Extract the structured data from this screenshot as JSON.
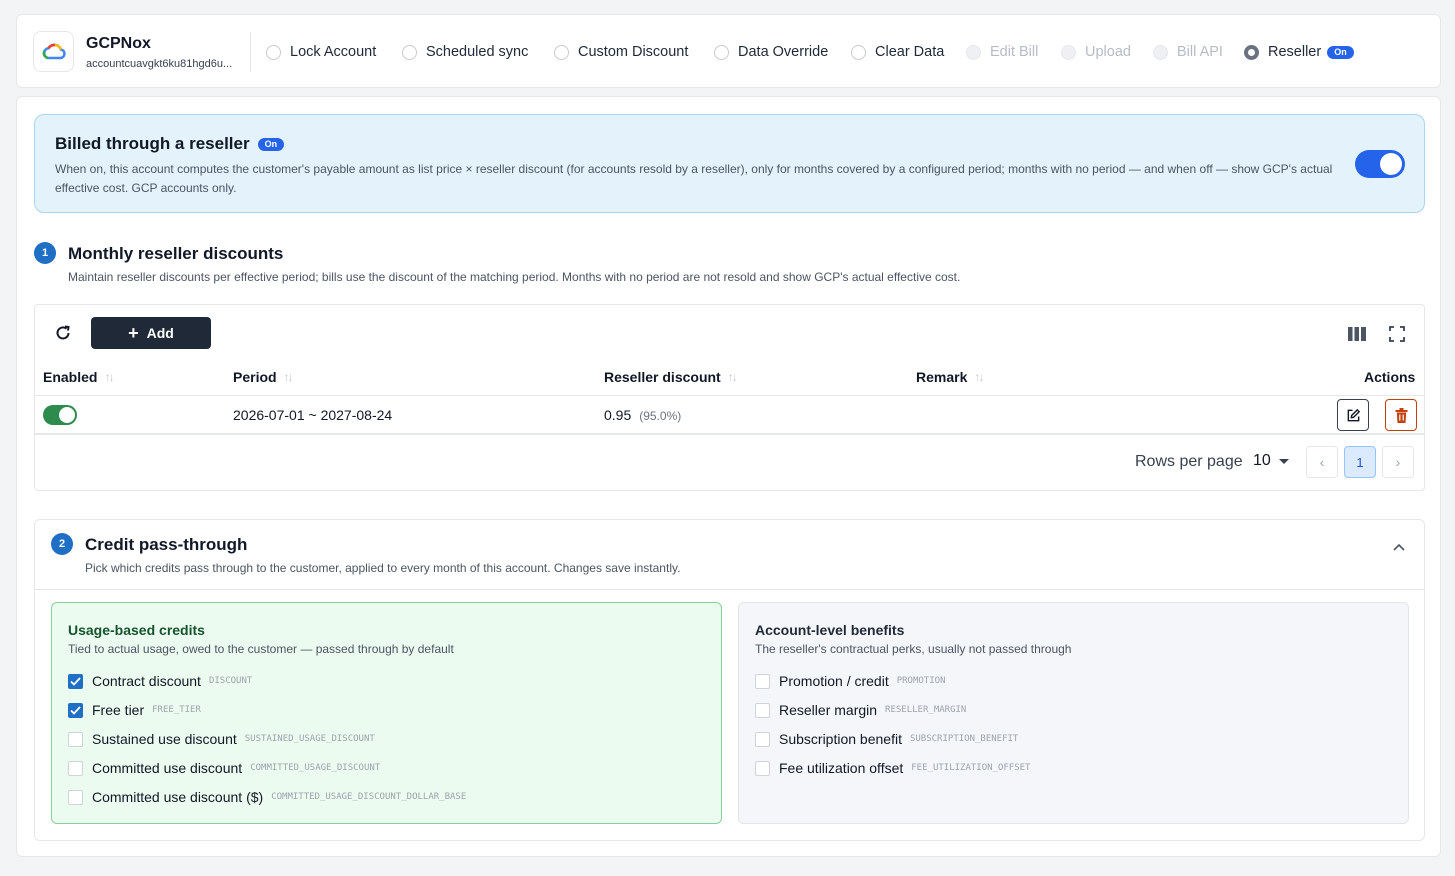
{
  "header": {
    "account_name": "GCPNox",
    "account_id": "accountcuavgkt6ku81hgd6u...",
    "options": [
      {
        "label": "Lock Account",
        "state": "enabled"
      },
      {
        "label": "Scheduled sync",
        "state": "enabled"
      },
      {
        "label": "Custom Discount",
        "state": "enabled"
      },
      {
        "label": "Data Override",
        "state": "enabled"
      },
      {
        "label": "Clear Data",
        "state": "enabled"
      },
      {
        "label": "Edit Bill",
        "state": "disabled"
      },
      {
        "label": "Upload",
        "state": "disabled"
      },
      {
        "label": "Bill API",
        "state": "disabled"
      },
      {
        "label": "Reseller",
        "state": "selected",
        "badge": "On"
      }
    ]
  },
  "banner": {
    "title": "Billed through a reseller",
    "badge": "On",
    "description": "When on, this account computes the customer's payable amount as list price × reseller discount (for accounts resold by a reseller), only for months covered by a configured period; months with no period — and when off — show GCP's actual effective cost. GCP accounts only.",
    "toggle_on": true
  },
  "section1": {
    "number": "1",
    "title": "Monthly reseller discounts",
    "description": "Maintain reseller discounts per effective period; bills use the discount of the matching period. Months with no period are not resold and show GCP's actual effective cost.",
    "add_label": "Add",
    "columns": {
      "enabled": "Enabled",
      "period": "Period",
      "discount": "Reseller discount",
      "remark": "Remark",
      "actions": "Actions"
    },
    "rows": [
      {
        "enabled": true,
        "period": "2026-07-01 ~ 2027-08-24",
        "discount": "0.95",
        "discount_pct": "(95.0%)",
        "remark": ""
      }
    ],
    "pagination": {
      "rows_per_page_label": "Rows per page",
      "rows_per_page": "10",
      "current_page": "1"
    }
  },
  "section2": {
    "number": "2",
    "title": "Credit pass-through",
    "description": "Pick which credits pass through to the customer, applied to every month of this account. Changes save instantly.",
    "usage": {
      "title": "Usage-based credits",
      "description": "Tied to actual usage, owed to the customer — passed through by default",
      "items": [
        {
          "label": "Contract discount",
          "code": "DISCOUNT",
          "checked": true
        },
        {
          "label": "Free tier",
          "code": "FREE_TIER",
          "checked": true
        },
        {
          "label": "Sustained use discount",
          "code": "SUSTAINED_USAGE_DISCOUNT",
          "checked": false
        },
        {
          "label": "Committed use discount",
          "code": "COMMITTED_USAGE_DISCOUNT",
          "checked": false
        },
        {
          "label": "Committed use discount ($)",
          "code": "COMMITTED_USAGE_DISCOUNT_DOLLAR_BASE",
          "checked": false
        }
      ]
    },
    "account": {
      "title": "Account-level benefits",
      "description": "The reseller's contractual perks, usually not passed through",
      "items": [
        {
          "label": "Promotion / credit",
          "code": "PROMOTION",
          "checked": false
        },
        {
          "label": "Reseller margin",
          "code": "RESELLER_MARGIN",
          "checked": false
        },
        {
          "label": "Subscription benefit",
          "code": "SUBSCRIPTION_BENEFIT",
          "checked": false
        },
        {
          "label": "Fee utilization offset",
          "code": "FEE_UTILIZATION_OFFSET",
          "checked": false
        }
      ]
    }
  },
  "colors": {
    "primary": "#2563eb",
    "step_badge": "#1f6fc5",
    "enabled_toggle": "#2e8b4e",
    "delete": "#c2410c",
    "banner_bg": "#e3f2fb",
    "green_panel_bg": "#ecfbef"
  }
}
